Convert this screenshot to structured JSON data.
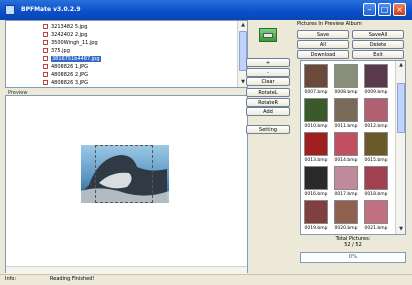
{
  "window": {
    "title": "BPFMate v3.0.2.9"
  },
  "file_list": {
    "items": [
      {
        "label": "3213482 5.jpg",
        "selected": false
      },
      {
        "label": "3242402 2.jpg",
        "selected": false
      },
      {
        "label": "3500Wingh_11.jpg",
        "selected": false
      },
      {
        "label": "375.jpg",
        "selected": false
      },
      {
        "label": "3816751b4487.jpg",
        "selected": true
      },
      {
        "label": "4808826 1.JPG",
        "selected": false
      },
      {
        "label": "4808826 2.JPG",
        "selected": false
      },
      {
        "label": "4808826 3.JPG",
        "selected": false
      }
    ]
  },
  "preview": {
    "label": "Preview"
  },
  "middle_buttons": {
    "plus": "+",
    "minus": "-",
    "clear": "Clear",
    "rotate_l": "RotateL",
    "rotate_r": "RotateR",
    "add": "Add",
    "setting": "Setting"
  },
  "album": {
    "header": "Pictures In Preview Album",
    "buttons": {
      "save": "Save",
      "save_all": "SaveAll",
      "all": "All",
      "delete": "Delete",
      "download": "Download",
      "exit": "Exit"
    },
    "thumbnails": [
      {
        "caption": "0007.bmp",
        "color": "#6a4a3a"
      },
      {
        "caption": "0008.bmp",
        "color": "#8a8f7a"
      },
      {
        "caption": "0009.bmp",
        "color": "#5a3a4a"
      },
      {
        "caption": "0010.bmp",
        "color": "#3a5a2a"
      },
      {
        "caption": "0011.bmp",
        "color": "#7a6a5a"
      },
      {
        "caption": "0012.bmp",
        "color": "#b06070"
      },
      {
        "caption": "0013.bmp",
        "color": "#a02020"
      },
      {
        "caption": "0014.bmp",
        "color": "#c05060"
      },
      {
        "caption": "0015.bmp",
        "color": "#6a5a2a"
      },
      {
        "caption": "0016.bmp",
        "color": "#2a2a2a"
      },
      {
        "caption": "0017.bmp",
        "color": "#c08a9a"
      },
      {
        "caption": "0018.bmp",
        "color": "#a04050"
      },
      {
        "caption": "0019.bmp",
        "color": "#804040"
      },
      {
        "caption": "0020.bmp",
        "color": "#906050"
      },
      {
        "caption": "0021.bmp",
        "color": "#c07080"
      }
    ],
    "total_label": "Total Pictures:",
    "total_value": "52 / 52",
    "progress_text": "0%",
    "progress": 0
  },
  "status": {
    "info_label": "Info:",
    "message": "Reading Finished!"
  }
}
